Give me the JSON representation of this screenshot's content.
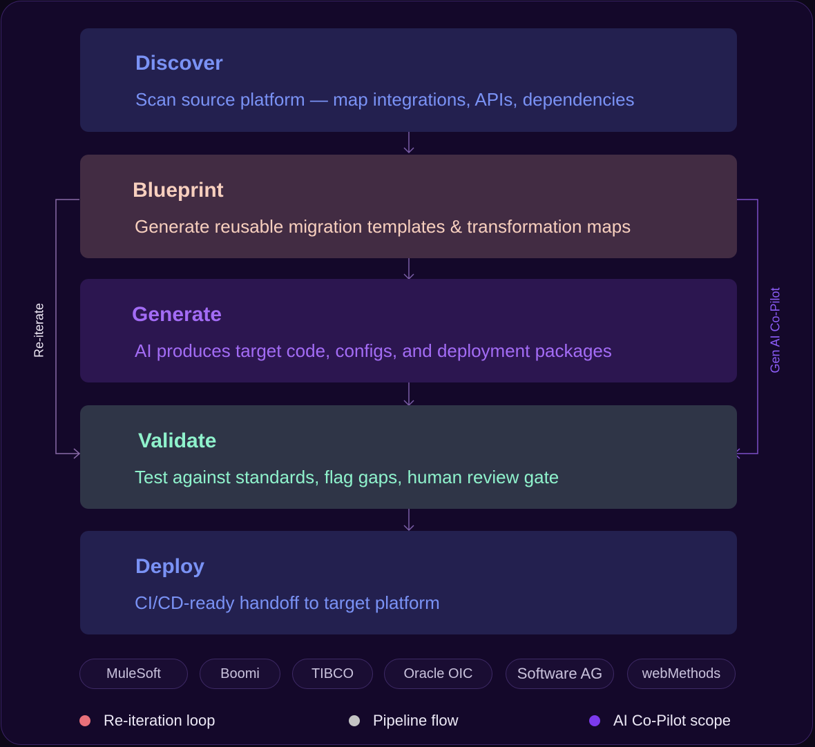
{
  "stages": [
    {
      "title": "Discover",
      "desc": "Scan source platform — map integrations, APIs, dependencies",
      "bg": "#23204f",
      "title_color": "#7a92f5",
      "desc_color": "#7a92f5"
    },
    {
      "title": "Blueprint",
      "desc": "Generate reusable migration templates & transformation maps",
      "bg": "#422c43",
      "title_color": "#f7cfbe",
      "desc_color": "#f7cfbe"
    },
    {
      "title": "Generate",
      "desc": "AI produces target code, configs, and deployment packages",
      "bg": "#2c1650",
      "title_color": "#a36cf5",
      "desc_color": "#a36cf5"
    },
    {
      "title": "Validate",
      "desc": "Test against standards, flag gaps, human review gate",
      "bg": "#2f3547",
      "title_color": "#8ff2cc",
      "desc_color": "#8ff2cc"
    },
    {
      "title": "Deploy",
      "desc": "CI/CD-ready handoff to target platform",
      "bg": "#23204f",
      "title_color": "#7a92f5",
      "desc_color": "#7a92f5"
    }
  ],
  "side_labels": {
    "left": "Re-iterate",
    "right": "Gen AI Co-Pilot"
  },
  "platforms": [
    "MuleSoft",
    "Boomi",
    "TIBCO",
    "Oracle OIC",
    "Software AG",
    "webMethods"
  ],
  "legend": [
    {
      "label": "Re-iteration loop",
      "color": "#e8707a"
    },
    {
      "label": "Pipeline flow",
      "color": "#c4c4c4"
    },
    {
      "label": "AI Co-Pilot scope",
      "color": "#7c3aed"
    }
  ],
  "colors": {
    "frame_bg": "#14082a",
    "frame_border": "#3a2266",
    "loop_line": "#8a6aa8",
    "copilot_line": "#7c4fc7",
    "arrow": "#7b5ea8"
  }
}
